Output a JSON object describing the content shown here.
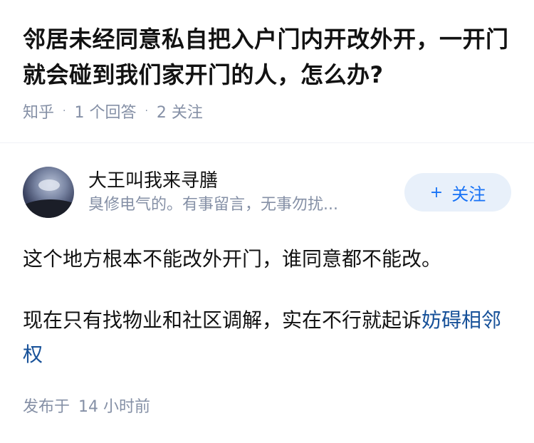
{
  "question": {
    "title": "邻居未经同意私自把入户门内开改外开，一开门就会碰到我们家开门的人，怎么办?",
    "source": "知乎",
    "answer_count": "1 个回答",
    "follower_count": "2 关注"
  },
  "answer": {
    "author": {
      "name": "大王叫我来寻膳",
      "bio": "臭修电气的。有事留言，无事勿扰..."
    },
    "follow_button": {
      "plus": "+",
      "label": "关注"
    },
    "paragraph1": "这个地方根本不能改外开门，谁同意都不能改。",
    "paragraph2_text": "现在只有找物业和社区调解，实在不行就起诉",
    "paragraph2_link": "妨碍相邻权",
    "published": {
      "label": "发布于",
      "time": "14 小时前"
    }
  },
  "colors": {
    "link": "#175199",
    "meta": "#8590a6",
    "follow_text": "#1772f6",
    "follow_bg": "#e8f0fa"
  }
}
